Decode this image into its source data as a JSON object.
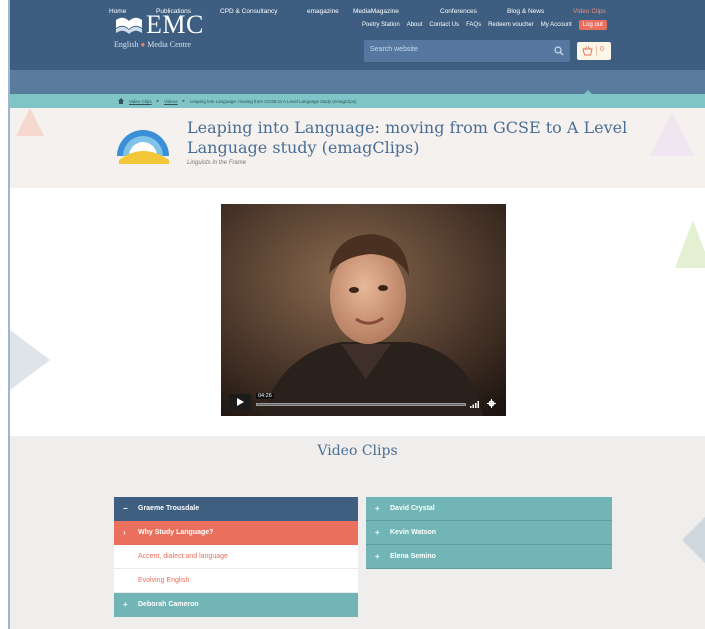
{
  "brand": {
    "logo_text": "EMC",
    "logo_sub_a": "English",
    "logo_sub_dot": "●",
    "logo_sub_b": "Media Centre"
  },
  "toplinks": [
    "Poetry Station",
    "About",
    "Contact Us",
    "FAQs",
    "Redeem voucher",
    "My Account"
  ],
  "logout_label": "Log out",
  "search": {
    "placeholder": "Search website"
  },
  "basket": {
    "count": "0"
  },
  "nav": [
    "Home",
    "Publications",
    "CPD & Consultancy",
    "emagazine",
    "MediaMagazine",
    "Conferences",
    "Blog & News",
    "Video Clips"
  ],
  "nav_active": "Video Clips",
  "breadcrumb": {
    "items": [
      "Video Clips",
      "Videos",
      "Leaping into Language: moving from GCSE to A Level Language study (emagClips)"
    ]
  },
  "page": {
    "title": "Leaping into Language: moving from GCSE to A Level Language study (emagClips)",
    "subtitle": "Linguists in the Frame"
  },
  "video": {
    "timecode": "04:26"
  },
  "clips": {
    "heading": "Video Clips",
    "left": [
      {
        "label": "Graeme Trousdale",
        "icon": "−",
        "style": "dark"
      },
      {
        "label": "Why Study Language?",
        "icon": "›",
        "style": "coral"
      },
      {
        "label": "Accent, dialect and language",
        "icon": "",
        "style": "white"
      },
      {
        "label": "Evolving English",
        "icon": "",
        "style": "white"
      },
      {
        "label": "Deborah Cameron",
        "icon": "+",
        "style": "teal"
      }
    ],
    "right": [
      {
        "label": "David Crystal",
        "icon": "+"
      },
      {
        "label": "Kevin Watson",
        "icon": "+"
      },
      {
        "label": "Elena Semino",
        "icon": "+"
      }
    ]
  },
  "colors": {
    "header": "#3d5e80",
    "nav": "#5a7c9c",
    "breadcrumb_bar": "#7fc4c6",
    "accent": "#ea705d",
    "teal": "#71b5b6",
    "title_text": "#4a6e95"
  }
}
